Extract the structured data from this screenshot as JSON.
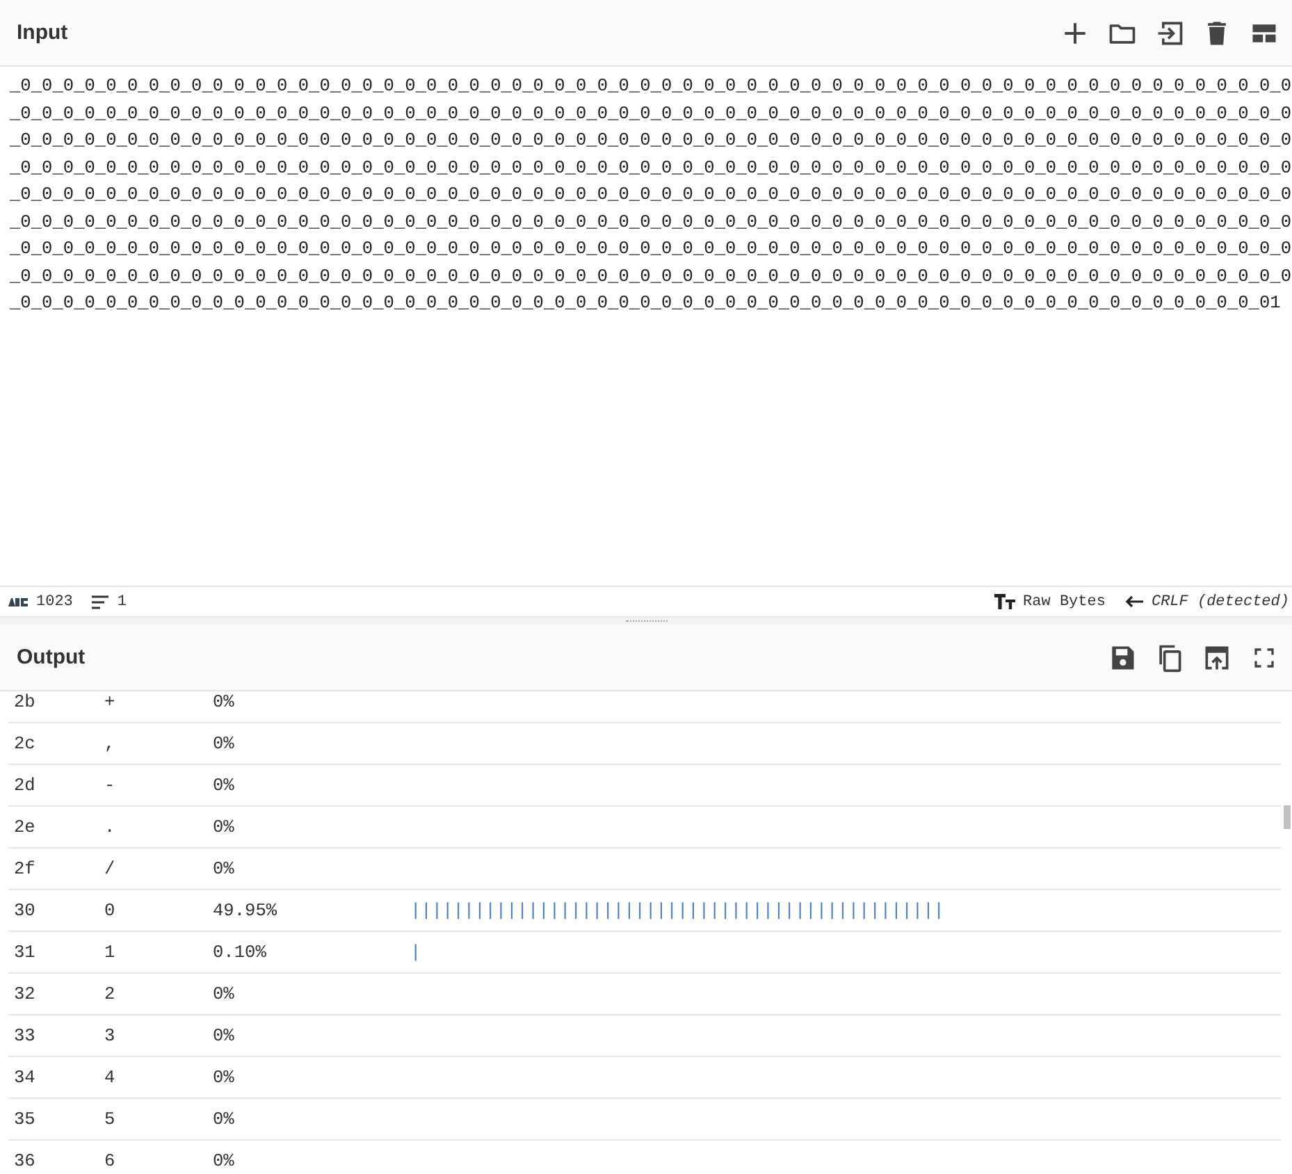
{
  "input": {
    "title": "Input",
    "value": "_0_0_0_0_0_0_0_0_0_0_0_0_0_0_0_0_0_0_0_0_0_0_0_0_0_0_0_0_0_0_0_0_0_0_0_0_0_0_0_0_0_0_0_0_0_0_0_0_0_0_0_0_0_0_0_0_0_0_0_0_0_0_0_0_0_0_0_0_0_0_0_0_0_0_0_0_0_0_0_0_0_0_0_0_0_0_0_0_0_0_0_0_0_0_0_0_0_0_0_0_0_0_0_0_0_0_0_0_0_0_0_0_0_0_0_0_0_0_0_0_0_0_0_0_0_0_0_0_0_0_0_0_0_0_0_0_0_0_0_0_0_0_0_0_0_0_0_0_0_0_0_0_0_0_0_0_0_0_0_0_0_0_0_0_0_0_0_0_0_0_0_0_0_0_0_0_0_0_0_0_0_0_0_0_0_0_0_0_0_0_0_0_0_0_0_0_0_0_0_0_0_0_0_0_0_0_0_0_0_0_0_0_0_0_0_0_0_0_0_0_0_0_0_0_0_0_0_0_0_0_0_0_0_0_0_0_0_0_0_0_0_0_0_0_0_0_0_0_0_0_0_0_0_0_0_0_0_0_0_0_0_0_0_0_0_0_0_0_0_0_0_0_0_0_0_0_0_0_0_0_0_0_0_0_0_0_0_0_0_0_0_0_0_0_0_0_0_0_0_0_0_0_0_0_0_0_0_0_0_0_0_0_0_0_0_0_0_0_0_0_0_0_0_0_0_0_0_0_0_0_0_0_0_0_0_0_0_0_0_0_0_0_0_0_0_0_0_0_0_0_0_0_0_0_0_0_0_0_0_0_0_0_0_0_0_0_0_0_0_0_0_0_0_0_0_0_0_0_0_0_0_0_0_0_0_0_0_0_0_0_0_0_0_0_0_0_0_0_0_0_0_0_0_0_0_0_0_0_0_0_0_0_0_0_0_0_0_0_0_0_0_0_0_0_0_0_0_0_0_0_0_0_0_0_0_0_0_0_0_0_0_0_0_0_0_0_0_0_0_0_0_0_0_0_0_0_0_0_0_0_0_0_0_0_0_0_0_0_0_0_0_0_0_0_0_0_0_0_0_0_0_0_0_0_0_0_0_0_0_0_0_0_0_0_0_0_0_0_0_0_0_0_0_0_0_0_0_0_0_0_0_0_0_0_0_0_0_0_0_0_0_0_0_0_0_0_0_0_0_0_0_0_0_0_0_0_0_0_01"
  },
  "input_status": {
    "length": "1023",
    "lines": "1",
    "encoding": "Raw Bytes",
    "eol": "CRLF (detected)"
  },
  "output": {
    "title": "Output",
    "rows": [
      {
        "hex": "2b",
        "char": "+",
        "percent": "0%"
      },
      {
        "hex": "2c",
        "char": ",",
        "percent": "0%"
      },
      {
        "hex": "2d",
        "char": "-",
        "percent": "0%"
      },
      {
        "hex": "2e",
        "char": ".",
        "percent": "0%"
      },
      {
        "hex": "2f",
        "char": "/",
        "percent": "0%"
      },
      {
        "hex": "30",
        "char": "0",
        "percent": "49.95%",
        "bar": "||||||||||||||||||||||||||||||||||||||||||||||||||"
      },
      {
        "hex": "31",
        "char": "1",
        "percent": "0.10%",
        "bar": "|"
      },
      {
        "hex": "32",
        "char": "2",
        "percent": "0%"
      },
      {
        "hex": "33",
        "char": "3",
        "percent": "0%"
      },
      {
        "hex": "34",
        "char": "4",
        "percent": "0%"
      },
      {
        "hex": "35",
        "char": "5",
        "percent": "0%"
      },
      {
        "hex": "36",
        "char": "6",
        "percent": "0%"
      }
    ]
  }
}
